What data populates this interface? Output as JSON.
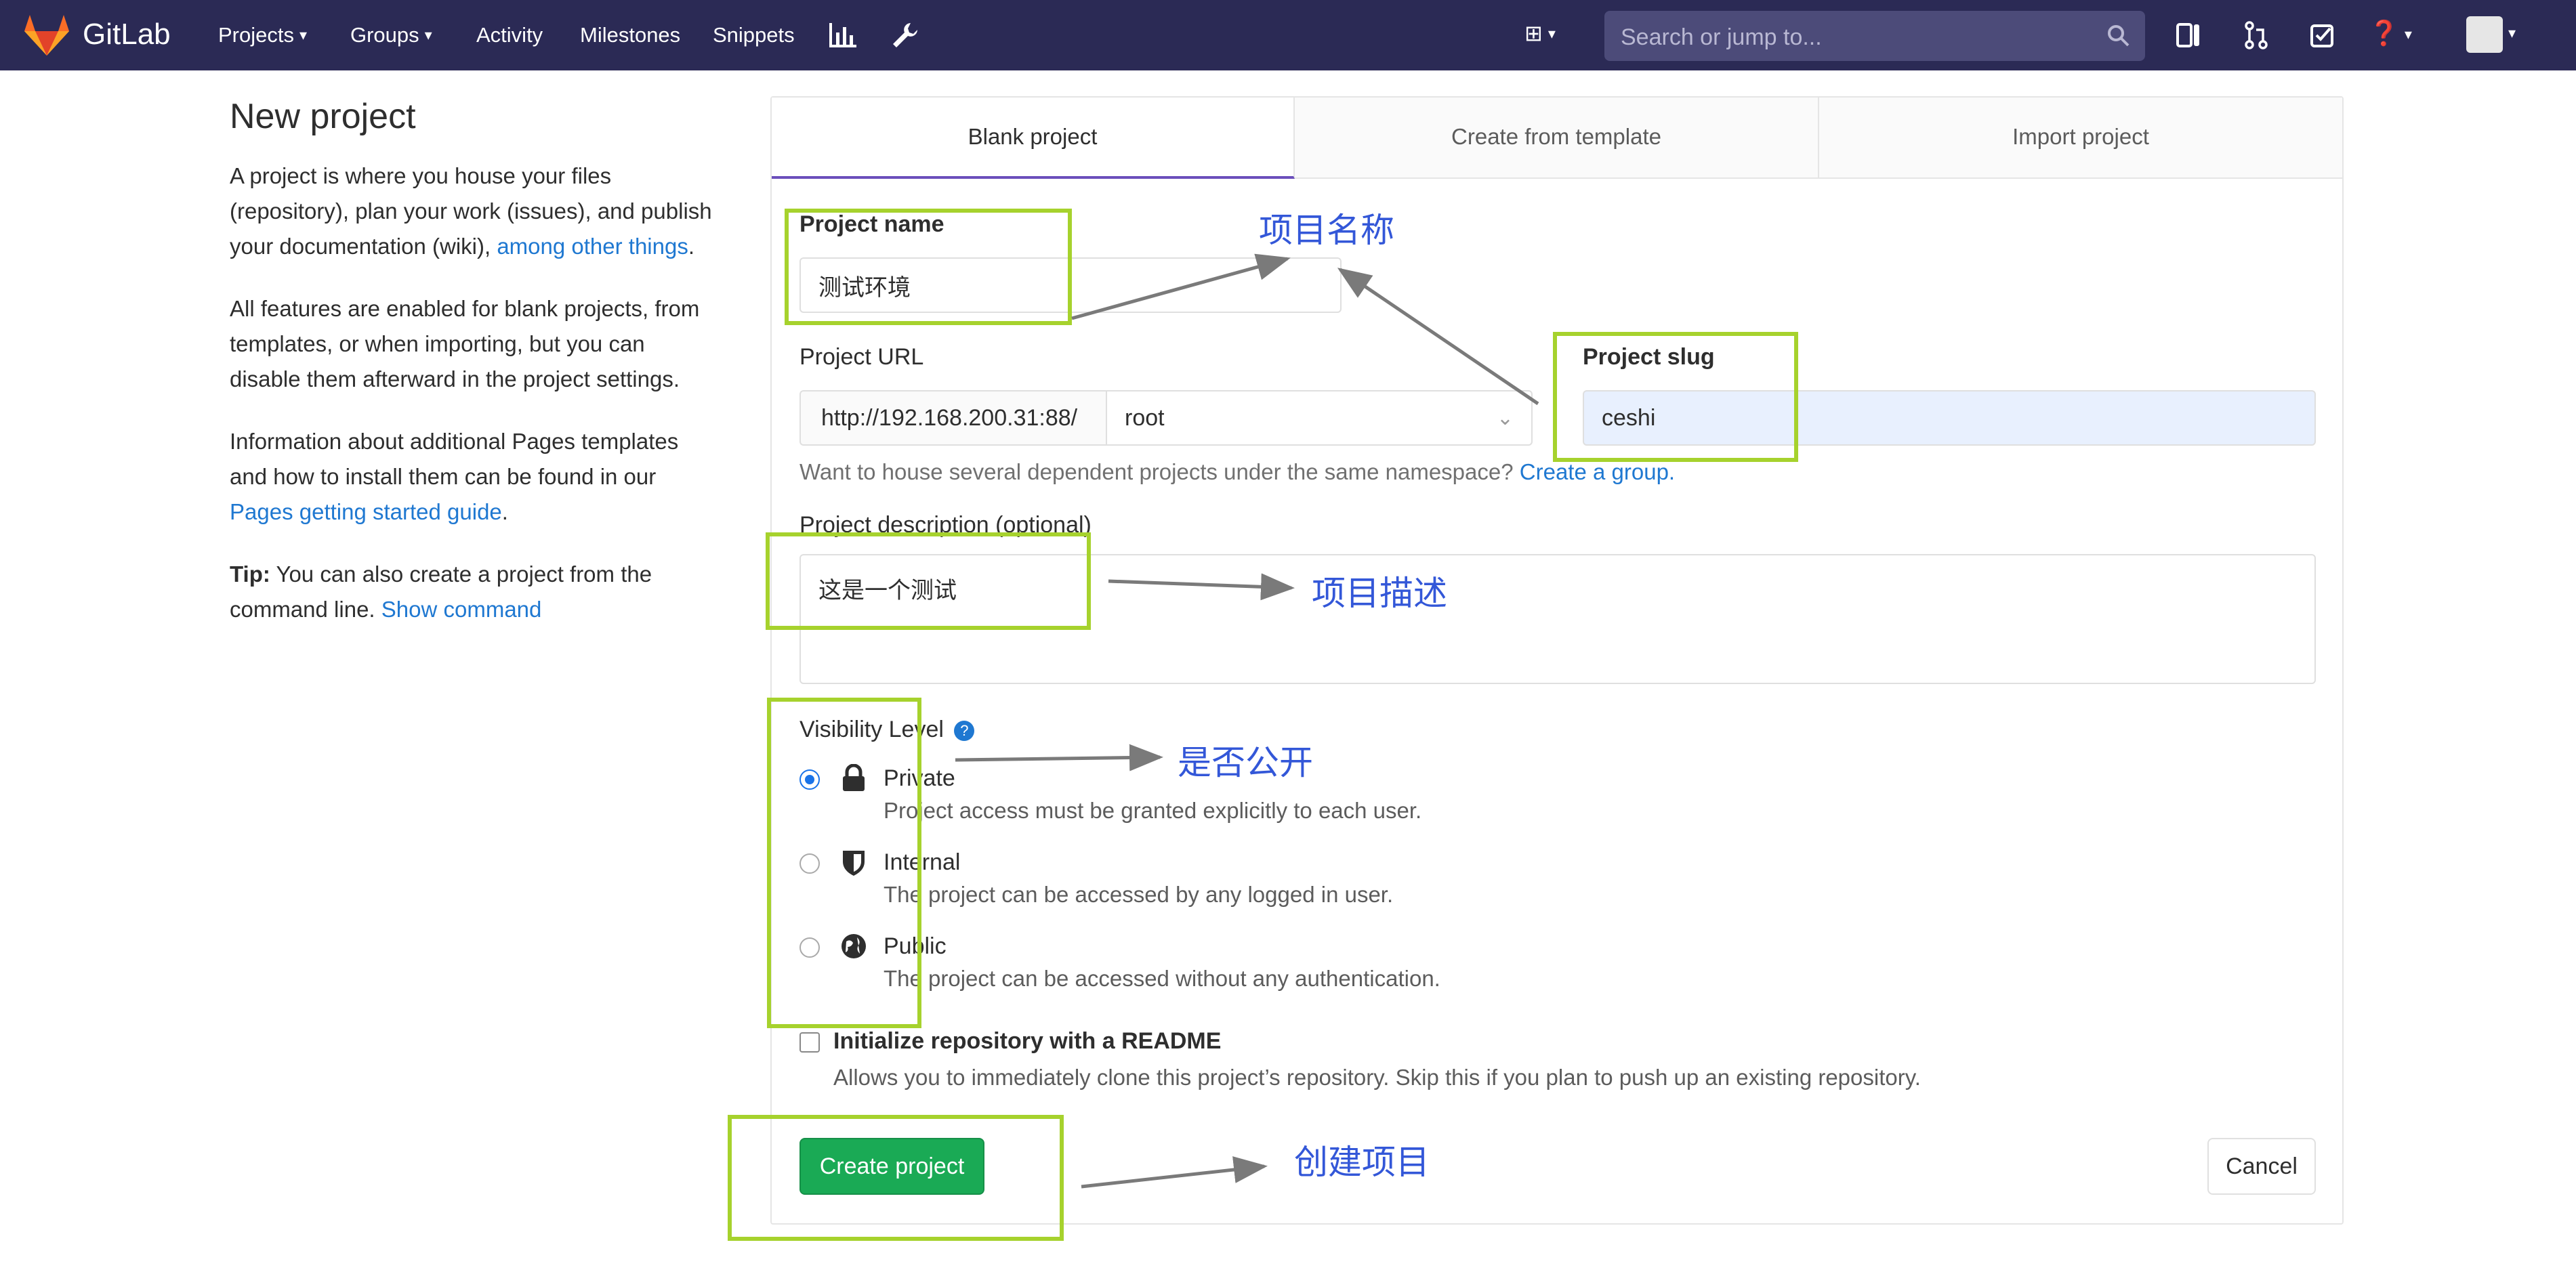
{
  "navbar": {
    "brand": "GitLab",
    "items": [
      {
        "label": "Projects",
        "has_caret": true
      },
      {
        "label": "Groups",
        "has_caret": true
      },
      {
        "label": "Activity"
      },
      {
        "label": "Milestones"
      },
      {
        "label": "Snippets"
      }
    ],
    "search_placeholder": "Search or jump to...",
    "accent_color": "#2b2a55"
  },
  "sidebar_info": {
    "title": "New project",
    "p1_text": "A project is where you house your files (repository), plan your work (issues), and publish your documentation (wiki),",
    "p1_link": "among other things",
    "p1_end": ".",
    "p2_text": "All features are enabled for blank projects, from templates, or when importing, but you can disable them afterward in the project settings.",
    "p3_text": "Information about additional Pages templates and how to install them can be found in our",
    "p3_link": "Pages getting started guide",
    "p3_end": ".",
    "tip_label": "Tip:",
    "tip_text": "You can also create a project from the command line.",
    "tip_link": "Show command"
  },
  "tabs": [
    {
      "label": "Blank project",
      "active": true
    },
    {
      "label": "Create from template",
      "active": false
    },
    {
      "label": "Import project",
      "active": false
    }
  ],
  "form": {
    "project_name_label": "Project name",
    "project_name_value": "测试环境",
    "project_url_label": "Project URL",
    "url_prefix": "http://192.168.200.31:88/",
    "namespace_value": "root",
    "slug_label": "Project slug",
    "slug_value": "ceshi",
    "namespace_help": "Want to house several dependent projects under the same namespace?",
    "namespace_help_link": "Create a group.",
    "description_label": "Project description (optional)",
    "description_value": "这是一个测试",
    "visibility_label": "Visibility Level",
    "visibility_options": [
      {
        "title": "Private",
        "desc": "Project access must be granted explicitly to each user.",
        "icon": "lock-icon",
        "checked": true
      },
      {
        "title": "Internal",
        "desc": "The project can be accessed by any logged in user.",
        "icon": "shield-icon",
        "checked": false
      },
      {
        "title": "Public",
        "desc": "The project can be accessed without any authentication.",
        "icon": "globe-icon",
        "checked": false
      }
    ],
    "readme_label": "Initialize repository with a README",
    "readme_desc": "Allows you to immediately clone this project’s repository. Skip this if you plan to push up an existing repository.",
    "readme_checked": false,
    "create_button": "Create project",
    "cancel_button": "Cancel"
  },
  "annotations": {
    "name": "项目名称",
    "description": "项目描述",
    "visibility": "是否公开",
    "create": "创建项目",
    "box_color": "#a6d22d",
    "text_color": "#3357d8"
  }
}
